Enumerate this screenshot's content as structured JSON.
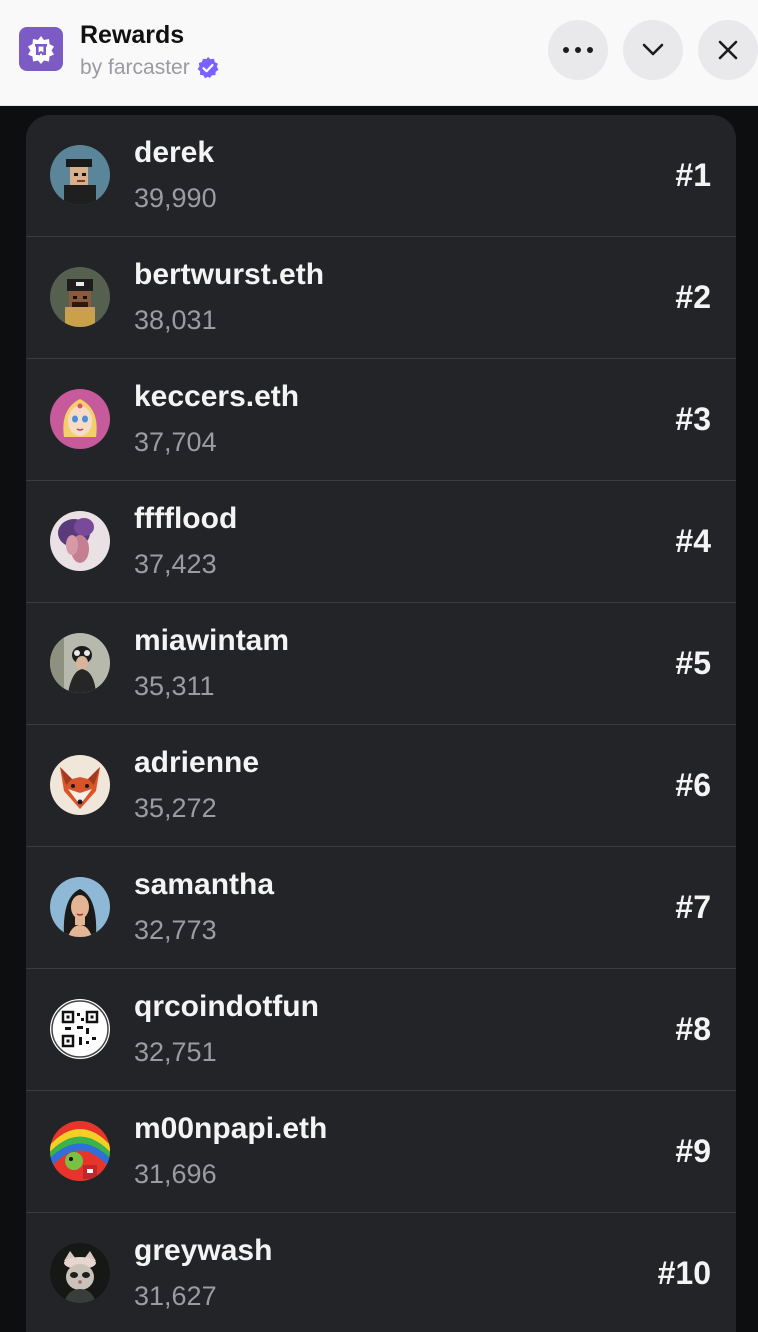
{
  "header": {
    "title": "Rewards",
    "subtitle": "by farcaster",
    "icons": {
      "app": "farcaster-arch-icon",
      "verified": "verified-badge-icon",
      "more": "more-horizontal-icon",
      "collapse": "chevron-down-icon",
      "close": "close-icon"
    }
  },
  "colors": {
    "accent": "#7c5cc4",
    "verified": "#7b61ff",
    "panel": "#232427",
    "divider": "#3b3c40",
    "score_text": "#9b9ca3"
  },
  "leaderboard": [
    {
      "name": "derek",
      "score": "39,990",
      "rank": "#1",
      "avatar": "pixel-punk-avatar"
    },
    {
      "name": "bertwurst.eth",
      "score": "38,031",
      "rank": "#2",
      "avatar": "pixel-cap-avatar"
    },
    {
      "name": "keccers.eth",
      "score": "37,704",
      "rank": "#3",
      "avatar": "anime-avatar"
    },
    {
      "name": "fffflood",
      "score": "37,423",
      "rank": "#4",
      "avatar": "flower-avatar"
    },
    {
      "name": "miawintam",
      "score": "35,311",
      "rank": "#5",
      "avatar": "photo-avatar"
    },
    {
      "name": "adrienne",
      "score": "35,272",
      "rank": "#6",
      "avatar": "fox-avatar"
    },
    {
      "name": "samantha",
      "score": "32,773",
      "rank": "#7",
      "avatar": "portrait-avatar"
    },
    {
      "name": "qrcoindotfun",
      "score": "32,751",
      "rank": "#8",
      "avatar": "qr-code-avatar"
    },
    {
      "name": "m00npapi.eth",
      "score": "31,696",
      "rank": "#9",
      "avatar": "rainbow-avatar"
    },
    {
      "name": "greywash",
      "score": "31,627",
      "rank": "#10",
      "avatar": "cat-avatar"
    }
  ]
}
